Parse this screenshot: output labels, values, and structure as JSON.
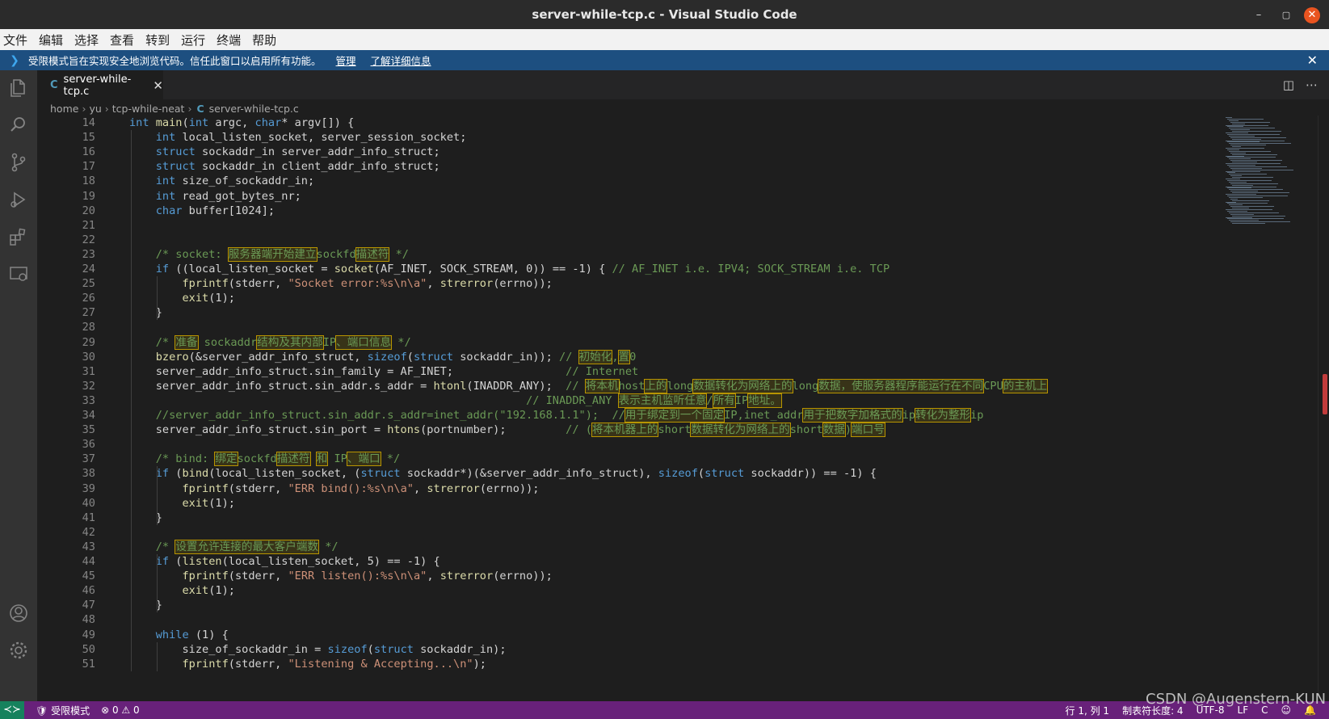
{
  "window": {
    "title": "server-while-tcp.c - Visual Studio Code"
  },
  "menu": [
    "文件",
    "编辑",
    "选择",
    "查看",
    "转到",
    "运行",
    "终端",
    "帮助"
  ],
  "banner": {
    "text": "受限模式旨在实现安全地浏览代码。信任此窗口以启用所有功能。",
    "manage": "管理",
    "learn_more": "了解详细信息"
  },
  "tab": {
    "lang": "C",
    "filename": "server-while-tcp.c"
  },
  "breadcrumb": {
    "parts": [
      "home",
      "yu",
      "tcp-while-neat"
    ],
    "lang": "C",
    "file": "server-while-tcp.c"
  },
  "code_lines": [
    {
      "n": "14",
      "t": "int main(int argc, char* argv[]) {"
    },
    {
      "n": "15",
      "t": "    int local_listen_socket, server_session_socket;"
    },
    {
      "n": "16",
      "t": "    struct sockaddr_in server_addr_info_struct;"
    },
    {
      "n": "17",
      "t": "    struct sockaddr_in client_addr_info_struct;"
    },
    {
      "n": "18",
      "t": "    int size_of_sockaddr_in;"
    },
    {
      "n": "19",
      "t": "    int read_got_bytes_nr;"
    },
    {
      "n": "20",
      "t": "    char buffer[1024];"
    },
    {
      "n": "21",
      "t": ""
    },
    {
      "n": "22",
      "t": ""
    },
    {
      "n": "23",
      "t": "    /* socket: 服务器端开始建立sockfd描述符 */"
    },
    {
      "n": "24",
      "t": "    if ((local_listen_socket = socket(AF_INET, SOCK_STREAM, 0)) == -1) { // AF_INET i.e. IPV4; SOCK_STREAM i.e. TCP"
    },
    {
      "n": "25",
      "t": "        fprintf(stderr, \"Socket error:%s\\n\\a\", strerror(errno));"
    },
    {
      "n": "26",
      "t": "        exit(1);"
    },
    {
      "n": "27",
      "t": "    }"
    },
    {
      "n": "28",
      "t": ""
    },
    {
      "n": "29",
      "t": "    /* 准备 sockaddr结构及其内部IP、端口信息 */"
    },
    {
      "n": "30",
      "t": "    bzero(&server_addr_info_struct, sizeof(struct sockaddr_in)); // 初始化,置0"
    },
    {
      "n": "31",
      "t": "    server_addr_info_struct.sin_family = AF_INET;                 // Internet"
    },
    {
      "n": "32",
      "t": "    server_addr_info_struct.sin_addr.s_addr = htonl(INADDR_ANY);  // 将本机host上的long数据转化为网络上的long数据，使服务器程序能运行在不同CPU的主机上"
    },
    {
      "n": "33",
      "t": "                                                            // INADDR_ANY 表示主机监听任意/所有IP地址。"
    },
    {
      "n": "34",
      "t": "    //server_addr_info_struct.sin_addr.s_addr=inet_addr(\"192.168.1.1\");  //用于绑定到一个固定IP,inet_addr用于把数字加格式的ip转化为整形ip"
    },
    {
      "n": "35",
      "t": "    server_addr_info_struct.sin_port = htons(portnumber);         // (将本机器上的short数据转化为网络上的short数据)端口号"
    },
    {
      "n": "36",
      "t": ""
    },
    {
      "n": "37",
      "t": "    /* bind: 绑定sockfd描述符 和 IP、端口 */"
    },
    {
      "n": "38",
      "t": "    if (bind(local_listen_socket, (struct sockaddr*)(&server_addr_info_struct), sizeof(struct sockaddr)) == -1) {"
    },
    {
      "n": "39",
      "t": "        fprintf(stderr, \"ERR bind():%s\\n\\a\", strerror(errno));"
    },
    {
      "n": "40",
      "t": "        exit(1);"
    },
    {
      "n": "41",
      "t": "    }"
    },
    {
      "n": "42",
      "t": ""
    },
    {
      "n": "43",
      "t": "    /* 设置允许连接的最大客户端数 */"
    },
    {
      "n": "44",
      "t": "    if (listen(local_listen_socket, 5) == -1) {"
    },
    {
      "n": "45",
      "t": "        fprintf(stderr, \"ERR listen():%s\\n\\a\", strerror(errno));"
    },
    {
      "n": "46",
      "t": "        exit(1);"
    },
    {
      "n": "47",
      "t": "    }"
    },
    {
      "n": "48",
      "t": ""
    },
    {
      "n": "49",
      "t": "    while (1) {"
    },
    {
      "n": "50",
      "t": "        size_of_sockaddr_in = sizeof(struct sockaddr_in);"
    },
    {
      "n": "51",
      "t": "        fprintf(stderr, \"Listening & Accepting...\\n\");"
    }
  ],
  "status": {
    "mode": "受限模式",
    "problems": "⊗ 0 ⚠ 0",
    "position": "行 1, 列 1",
    "tabs": "制表符长度: 4",
    "encoding": "UTF-8",
    "eol": "LF",
    "language": "C"
  },
  "watermark": "CSDN @Augenstern-KUN",
  "colors": {
    "statusbar": "#68217a",
    "banner": "#1d4f80",
    "keyword": "#569cd6",
    "function": "#dcdcaa",
    "string": "#ce9178",
    "comment": "#6a9955"
  }
}
